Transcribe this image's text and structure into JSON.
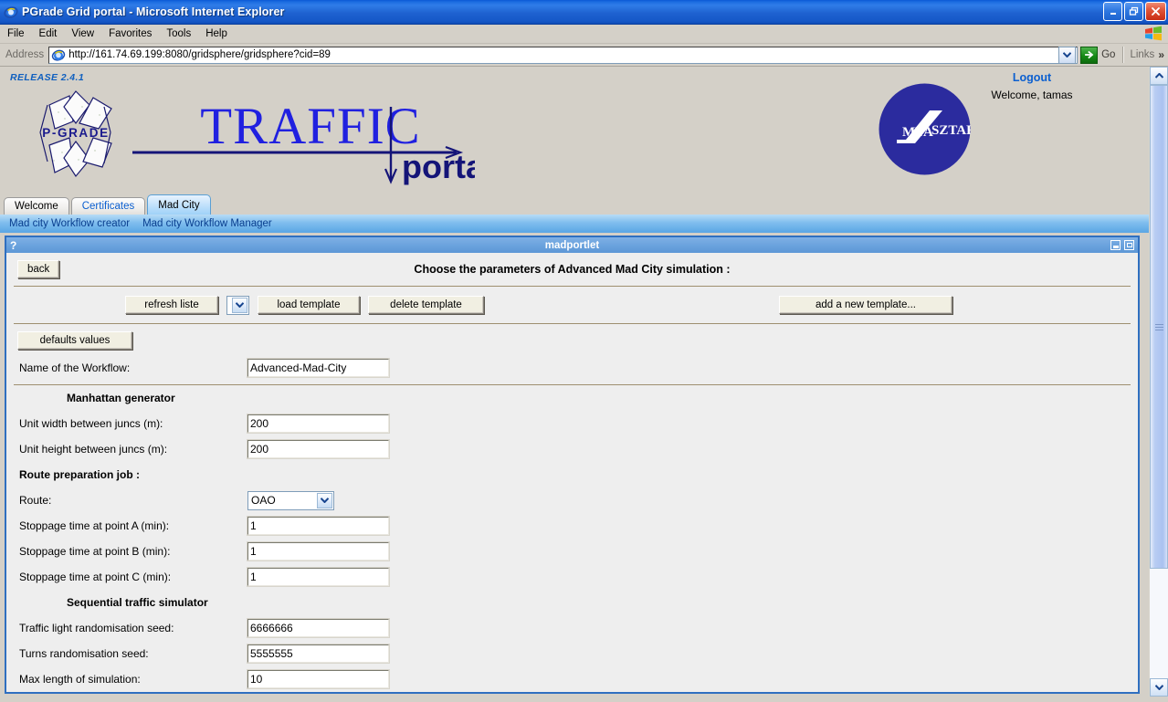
{
  "window": {
    "title": "PGrade Grid portal - Microsoft Internet Explorer",
    "icon": "ie-icon",
    "minimize_label": "Minimize",
    "restore_label": "Restore",
    "close_label": "Close"
  },
  "menubar": {
    "items": [
      "File",
      "Edit",
      "View",
      "Favorites",
      "Tools",
      "Help"
    ]
  },
  "addressbar": {
    "label": "Address",
    "url": "http://161.74.69.199:8080/gridsphere/gridsphere?cid=89",
    "go_label": "Go",
    "links_label": "Links",
    "overflow_label": "»"
  },
  "portal": {
    "release": "RELEASE 2.4.1",
    "logo_pgrade_text": "P-GRADE",
    "logo_traffic_text": "TRAFFIC",
    "logo_portal_text": "portal",
    "logo_sztaki_left": "MTA",
    "logo_sztaki_right": "SZTAKI",
    "logout_label": "Logout",
    "welcome_text": "Welcome, tamas"
  },
  "tabs": [
    {
      "label": "Welcome",
      "state": "inactive-plain"
    },
    {
      "label": "Certificates",
      "state": "inactive-link"
    },
    {
      "label": "Mad City",
      "state": "active"
    }
  ],
  "subnav": [
    {
      "label": "Mad city Workflow creator"
    },
    {
      "label": "Mad city Workflow Manager"
    }
  ],
  "portlet": {
    "help_glyph": "?",
    "name": "madportlet",
    "minimize_label": "Minimize portlet",
    "maximize_label": "Maximize portlet",
    "back_label": "back",
    "heading": "Choose the parameters of Advanced Mad City simulation :"
  },
  "toolbar": {
    "refresh_label": "refresh liste",
    "template_select_value": "",
    "load_label": "load template",
    "delete_label": "delete template",
    "add_label": "add a new template..."
  },
  "form": {
    "defaults_label": "defaults values",
    "workflow_name_label": "Name of the Workflow:",
    "workflow_name_value": "Advanced-Mad-City",
    "sections": [
      {
        "title": "Manhattan generator",
        "title_align": "indent",
        "fields": [
          {
            "label": "Unit width between juncs (m):",
            "type": "text",
            "value": "200"
          },
          {
            "label": "Unit height between juncs (m):",
            "type": "text",
            "value": "200"
          }
        ]
      },
      {
        "title": "Route preparation job :",
        "title_align": "left",
        "fields": [
          {
            "label": "Route:",
            "type": "select",
            "value": "OAO"
          },
          {
            "label": "Stoppage time at point A (min):",
            "type": "text",
            "value": "1"
          },
          {
            "label": "Stoppage time at point B (min):",
            "type": "text",
            "value": "1"
          },
          {
            "label": "Stoppage time at point C (min):",
            "type": "text",
            "value": "1"
          }
        ]
      },
      {
        "title": "Sequential traffic simulator",
        "title_align": "indent",
        "fields": [
          {
            "label": "Traffic light randomisation seed:",
            "type": "text",
            "value": "6666666"
          },
          {
            "label": "Turns randomisation seed:",
            "type": "text",
            "value": "5555555"
          },
          {
            "label": "Max length of simulation:",
            "type": "text",
            "value": "10"
          }
        ]
      }
    ]
  },
  "colors": {
    "titlebar_blue": "#1e62d0",
    "portlet_blue": "#2f6fc0",
    "subnav_blue": "#7fbdee",
    "link_blue": "#0b5fd0",
    "logo_blue": "#2020c0",
    "chrome_gray": "#d4d0c8",
    "portlet_bg": "#eeeeee",
    "divider_olive": "#9e8f6f"
  }
}
